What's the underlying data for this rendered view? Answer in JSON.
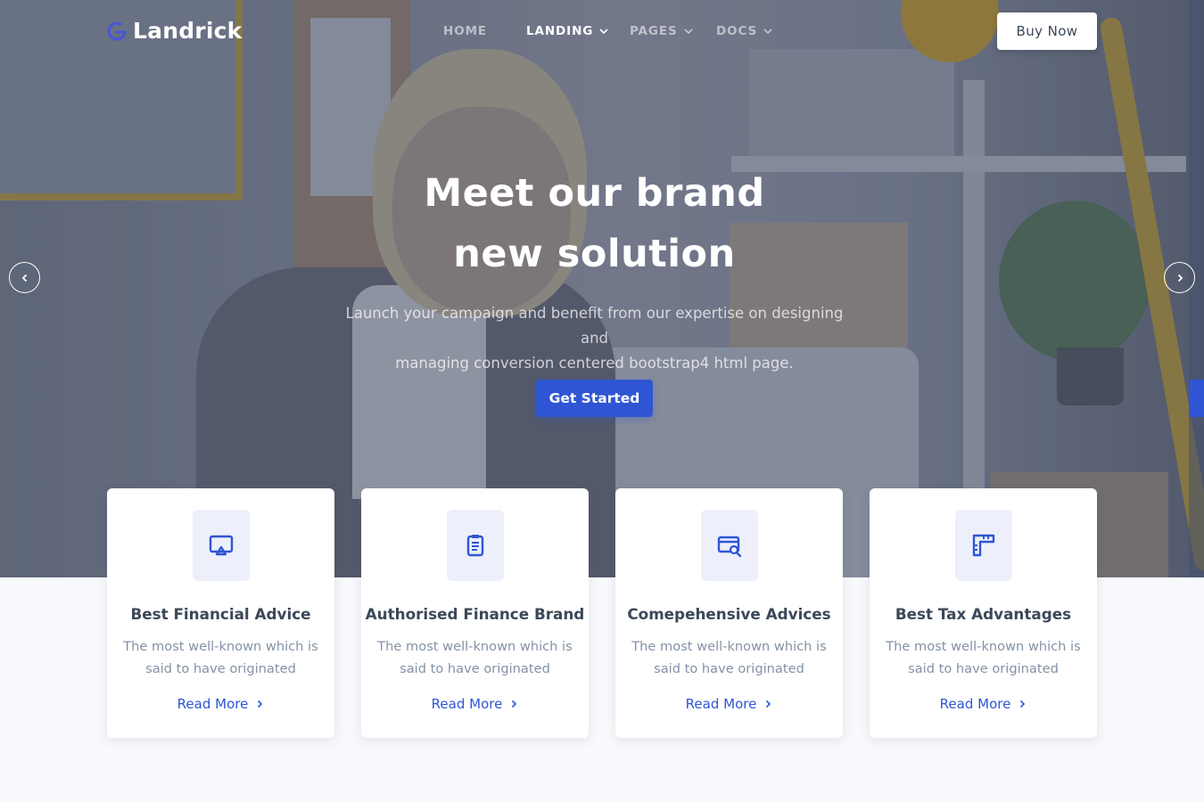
{
  "brand": {
    "name": "Landrick",
    "accent": "#2f55d4"
  },
  "nav": {
    "items": [
      {
        "label": "HOME",
        "dropdown": false,
        "active": false
      },
      {
        "label": "LANDING",
        "dropdown": true,
        "active": true
      },
      {
        "label": "PAGES",
        "dropdown": true,
        "active": false
      },
      {
        "label": "DOCS",
        "dropdown": true,
        "active": false
      }
    ],
    "buy_label": "Buy Now"
  },
  "hero": {
    "title_line1": "Meet our brand",
    "title_line2": "new solution",
    "description_line1": "Launch your campaign and benefit from our expertise on designing and",
    "description_line2": "managing conversion centered bootstrap4 html page.",
    "cta_label": "Get Started",
    "prev_icon": "chevron-left-icon",
    "next_icon": "chevron-right-icon"
  },
  "features": [
    {
      "icon": "presentation-icon",
      "title": "Best Financial Advice",
      "desc_line1": "The most well-known which is",
      "desc_line2": "said to have originated",
      "link": "Read More"
    },
    {
      "icon": "clipboard-icon",
      "title": "Authorised Finance Brand",
      "desc_line1": "The most well-known which is",
      "desc_line2": "said to have originated",
      "link": "Read More"
    },
    {
      "icon": "credit-card-search-icon",
      "title": "Comepehensive Advices",
      "desc_line1": "The most well-known which is",
      "desc_line2": "said to have originated",
      "link": "Read More"
    },
    {
      "icon": "ruler-combined-icon",
      "title": "Best Tax Advantages",
      "desc_line1": "The most well-known which is",
      "desc_line2": "said to have originated",
      "link": "Read More"
    }
  ]
}
